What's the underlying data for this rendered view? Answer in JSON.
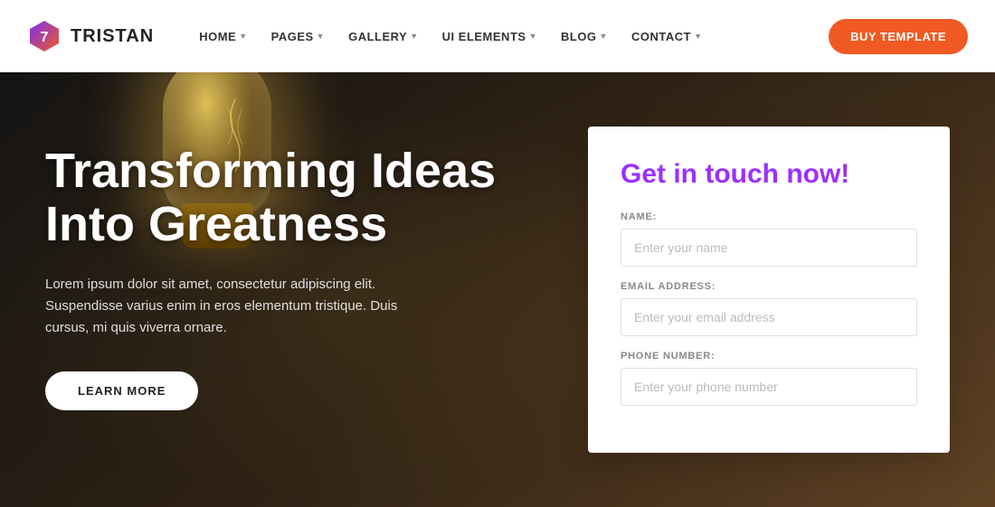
{
  "brand": {
    "name": "TRISTAN"
  },
  "nav": {
    "items": [
      {
        "label": "HOME",
        "has_dropdown": true
      },
      {
        "label": "PAGES",
        "has_dropdown": true
      },
      {
        "label": "GALLERY",
        "has_dropdown": true
      },
      {
        "label": "UI ELEMENTS",
        "has_dropdown": true
      },
      {
        "label": "BLOG",
        "has_dropdown": true
      },
      {
        "label": "CONTACT",
        "has_dropdown": true
      }
    ],
    "cta_label": "BUY TEMPLATE"
  },
  "hero": {
    "title": "Transforming Ideas Into Greatness",
    "subtitle": "Lorem ipsum dolor sit amet, consectetur adipiscing elit. Suspendisse varius enim in eros elementum tristique. Duis cursus, mi quis viverra ornare.",
    "cta_label": "LEARN MORE"
  },
  "contact_form": {
    "title": "Get in touch now!",
    "fields": [
      {
        "label": "NAME:",
        "placeholder": "Enter your name",
        "type": "text"
      },
      {
        "label": "EMAIL ADDRESS:",
        "placeholder": "Enter your email address",
        "type": "email"
      },
      {
        "label": "PHONE NUMBER:",
        "placeholder": "Enter your phone number",
        "type": "tel"
      }
    ]
  },
  "colors": {
    "accent_orange": "#f05a22",
    "accent_purple": "#9b30ff",
    "nav_bg": "#ffffff",
    "hero_text": "#ffffff"
  }
}
